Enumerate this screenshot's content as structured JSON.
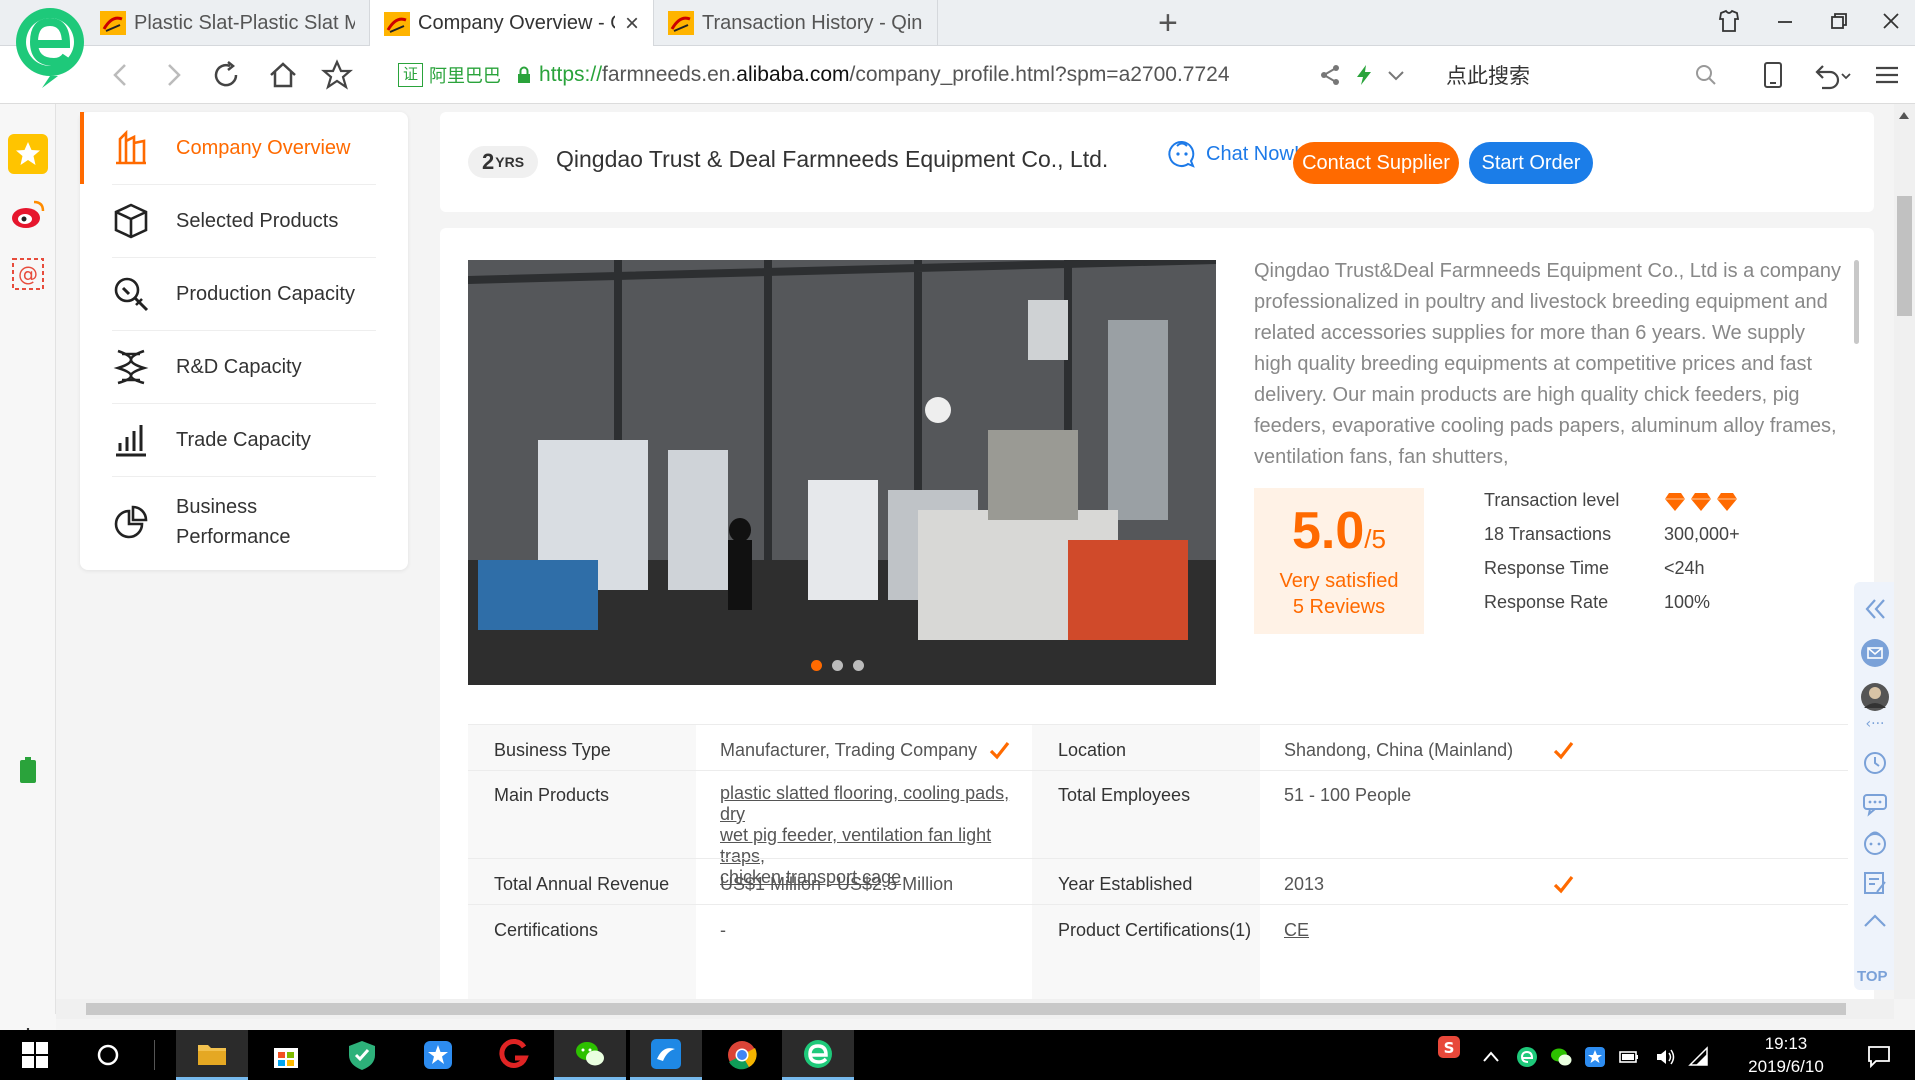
{
  "browser": {
    "tabs": [
      {
        "title": "Plastic Slat-Plastic Slat Manufa",
        "active": false
      },
      {
        "title": "Company Overview - Qingdao",
        "active": true
      },
      {
        "title": "Transaction History - Qingdao",
        "active": false
      }
    ],
    "close_glyph": "×",
    "new_tab_glyph": "+",
    "address": {
      "cert_badge": "证",
      "cert_name": "阿里巴巴",
      "scheme": "https://",
      "subdomain": "farmneeds.en.",
      "host": "alibaba.com",
      "path": "/company_profile.html?spm=a2700.7724"
    },
    "search_placeholder": "点此搜索"
  },
  "nav": {
    "items": [
      {
        "label": "Company Overview",
        "icon": "factory-icon",
        "active": true
      },
      {
        "label": "Selected Products",
        "icon": "box-icon"
      },
      {
        "label": "Production Capacity",
        "icon": "wrench-search-icon"
      },
      {
        "label": "R&D Capacity",
        "icon": "dna-icon"
      },
      {
        "label": "Trade Capacity",
        "icon": "bar-chart-icon"
      },
      {
        "label_line1": "Business",
        "label_line2": "Performance",
        "icon": "pie-chart-icon"
      }
    ]
  },
  "header": {
    "years_number": "2",
    "years_unit": "YRS",
    "company_name": "Qingdao Trust & Deal Farmneeds Equipment Co., Ltd.",
    "chat_label": "Chat Now!",
    "contact_label": "Contact Supplier",
    "order_label": "Start Order"
  },
  "overview": {
    "description": "Qingdao Trust&Deal Farmneeds Equipment Co., Ltd is a company professionalized in poultry and livestock breeding equipment and related accessories supplies for more than 6 years. We supply high quality breeding equipments at competitive prices and fast delivery. Our main products are high quality chick feeders, pig feeders, evaporative cooling pads papers, aluminum alloy frames, ventilation fans, fan shutters,",
    "photo_slides": 3,
    "photo_active_slide": 1,
    "rating": {
      "score": "5.0",
      "out_of": "/5",
      "label": "Very satisfied",
      "reviews": "5 Reviews"
    },
    "metrics": [
      {
        "label": "Transaction level",
        "value": "",
        "diamonds": 3
      },
      {
        "label": "18 Transactions",
        "value": "300,000+"
      },
      {
        "label": "Response Time",
        "value": "<24h"
      },
      {
        "label": "Response Rate",
        "value": "100%"
      }
    ]
  },
  "info_table": {
    "rows": [
      {
        "l1": "Business Type",
        "v1": "Manufacturer, Trading Company",
        "v1_verified": true,
        "l2": "Location",
        "v2": "Shandong, China (Mainland)",
        "v2_verified": true
      },
      {
        "l1": "Main Products",
        "v1_line1": "plastic slatted flooring, cooling pads, dry",
        "v1_line2": "wet pig feeder, ventilation fan light traps,",
        "v1_line3": "chicken transport cage",
        "l2": "Total Employees",
        "v2": "51 - 100 People"
      },
      {
        "l1": "Total Annual Revenue",
        "v1": "US$1 Million - US$2.5 Million",
        "l2": "Year Established",
        "v2": "2013",
        "v2_verified": true
      },
      {
        "l1": "Certifications",
        "v1": "-",
        "l2": "Product Certifications(1)",
        "v2": "CE"
      }
    ]
  },
  "float_tools": {
    "top_label": "TOP"
  },
  "taskbar": {
    "apps": [
      "file-explorer-icon",
      "store-icon",
      "security-shield-icon",
      "star-app-icon",
      "red-g-icon",
      "wechat-icon",
      "alibaba-supplier-icon",
      "chrome-icon",
      "browser-e-icon"
    ],
    "time": "19:13",
    "date": "2019/6/10"
  },
  "colors": {
    "accent": "#ff6a00",
    "blue": "#1b7de8",
    "green": "#2aa33b"
  }
}
